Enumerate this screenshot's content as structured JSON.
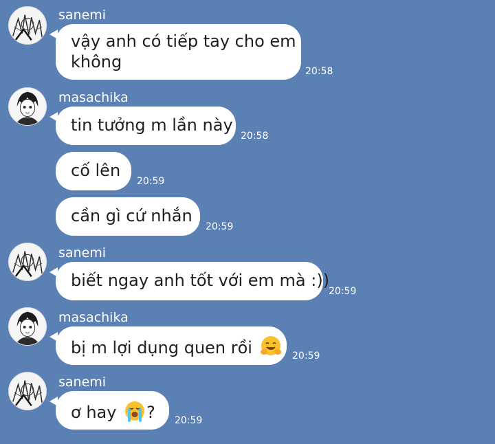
{
  "colors": {
    "background": "#5b80b4",
    "bubble": "#ffffff",
    "text": "#1f1f1f",
    "meta_text": "#ffffff"
  },
  "messages": [
    {
      "sender": "sanemi",
      "lines": [
        "vậy anh có tiếp tay cho em",
        "không"
      ],
      "time": "20:58",
      "avatar": "sanemi-avatar"
    },
    {
      "sender": "masachika",
      "text": "tin tưởng m lần này",
      "time": "20:58",
      "avatar": "masachika-avatar"
    },
    {
      "text": "cố lên",
      "time": "20:59"
    },
    {
      "text": "cần gì cứ nhắn",
      "time": "20:59"
    },
    {
      "sender": "sanemi",
      "text": "biết ngay anh tốt với em mà :))",
      "time": "20:59",
      "avatar": "sanemi-avatar"
    },
    {
      "sender": "masachika",
      "text": "bị m lợi dụng quen rồi",
      "emoji": "hugging-face-emoji",
      "time": "20:59",
      "avatar": "masachika-avatar"
    },
    {
      "sender": "sanemi",
      "text_before": "ơ hay",
      "emoji": "loudly-crying-face-emoji",
      "text_after": "?",
      "time": "20:59",
      "avatar": "sanemi-avatar"
    }
  ]
}
